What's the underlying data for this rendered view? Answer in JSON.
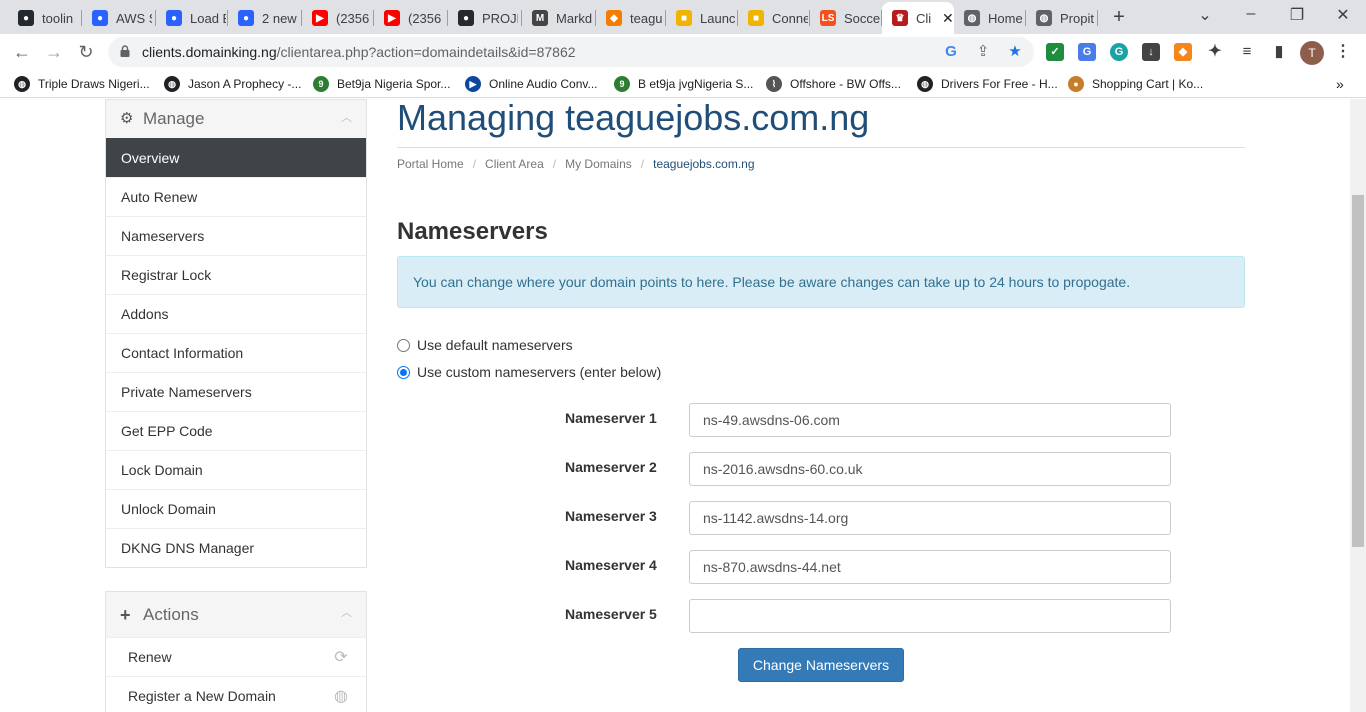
{
  "browser": {
    "tabs": [
      {
        "label": "toolin",
        "icon": "github-icon",
        "color": "#24292f"
      },
      {
        "label": "AWS S",
        "icon": "blog-icon",
        "color": "#2962ff"
      },
      {
        "label": "Load E",
        "icon": "blog-icon",
        "color": "#2962ff"
      },
      {
        "label": "2 new",
        "icon": "blog-icon",
        "color": "#2962ff"
      },
      {
        "label": "(2356",
        "icon": "youtube-icon",
        "color": "#ff0000"
      },
      {
        "label": "(2356",
        "icon": "youtube-icon",
        "color": "#ff0000"
      },
      {
        "label": "PROJE",
        "icon": "github-icon",
        "color": "#24292f"
      },
      {
        "label": "Markd",
        "icon": "markdown-icon",
        "color": "#444444"
      },
      {
        "label": "teagu",
        "icon": "cube-icon",
        "color": "#f57c00"
      },
      {
        "label": "Launc",
        "icon": "box-icon",
        "color": "#f0b400"
      },
      {
        "label": "Conne",
        "icon": "box-icon",
        "color": "#f0b400"
      },
      {
        "label": "Socce",
        "icon": "ls-icon",
        "color": "#f4511e"
      },
      {
        "label": "Cli",
        "icon": "crown-icon",
        "color": "#b71c1c"
      },
      {
        "label": "Home",
        "icon": "globe-icon",
        "color": "#5f6368"
      },
      {
        "label": "Propit",
        "icon": "globe-icon",
        "color": "#5f6368"
      }
    ],
    "url_host": "clients.domainking.ng",
    "url_path": "/clientarea.php?action=domaindetails&id=87862",
    "profile_initial": "T",
    "bookmarks": [
      {
        "label": "Triple Draws Nigeri...",
        "icon": "globe-icon",
        "color": "#202124"
      },
      {
        "label": "Jason A Prophecy -...",
        "icon": "globe-icon",
        "color": "#202124"
      },
      {
        "label": "Bet9ja Nigeria Spor...",
        "icon": "9ja-icon",
        "color": "#2e7d32"
      },
      {
        "label": "Online Audio Conv...",
        "icon": "play-icon",
        "color": "#0d47a1"
      },
      {
        "label": "B et9ja jvgNigeria S...",
        "icon": "9ja-icon",
        "color": "#2e7d32"
      },
      {
        "label": "Offshore - BW Offs...",
        "icon": "bw-icon",
        "color": "#555555"
      },
      {
        "label": "Drivers For Free - H...",
        "icon": "globe-icon",
        "color": "#202124"
      },
      {
        "label": "Shopping Cart | Ko...",
        "icon": "cart-icon",
        "color": "#c77c2a"
      }
    ]
  },
  "sidebar": {
    "manage_title": "Manage",
    "manage_items": [
      "Overview",
      "Auto Renew",
      "Nameservers",
      "Registrar Lock",
      "Addons",
      "Contact Information",
      "Private Nameservers",
      "Get EPP Code",
      "Lock Domain",
      "Unlock Domain",
      "DKNG DNS Manager"
    ],
    "actions_title": "Actions",
    "action_items": [
      {
        "label": "Renew",
        "icon": "refresh-icon"
      },
      {
        "label": "Register a New Domain",
        "icon": "globe-icon"
      }
    ]
  },
  "main": {
    "title": "Managing teaguejobs.com.ng",
    "breadcrumb": [
      "Portal Home",
      "Client Area",
      "My Domains",
      "teaguejobs.com.ng"
    ],
    "section_title": "Nameservers",
    "alert": "You can change where your domain points to here. Please be aware changes can take up to 24 hours to propogate.",
    "radio_default": "Use default nameservers",
    "radio_custom": "Use custom nameservers (enter below)",
    "selected_option": "custom",
    "nameservers": [
      {
        "label": "Nameserver 1",
        "value": "ns-49.awsdns-06.com"
      },
      {
        "label": "Nameserver 2",
        "value": "ns-2016.awsdns-60.co.uk"
      },
      {
        "label": "Nameserver 3",
        "value": "ns-1142.awsdns-14.org"
      },
      {
        "label": "Nameserver 4",
        "value": "ns-870.awsdns-44.net"
      },
      {
        "label": "Nameserver 5",
        "value": ""
      }
    ],
    "submit_label": "Change Nameservers"
  }
}
